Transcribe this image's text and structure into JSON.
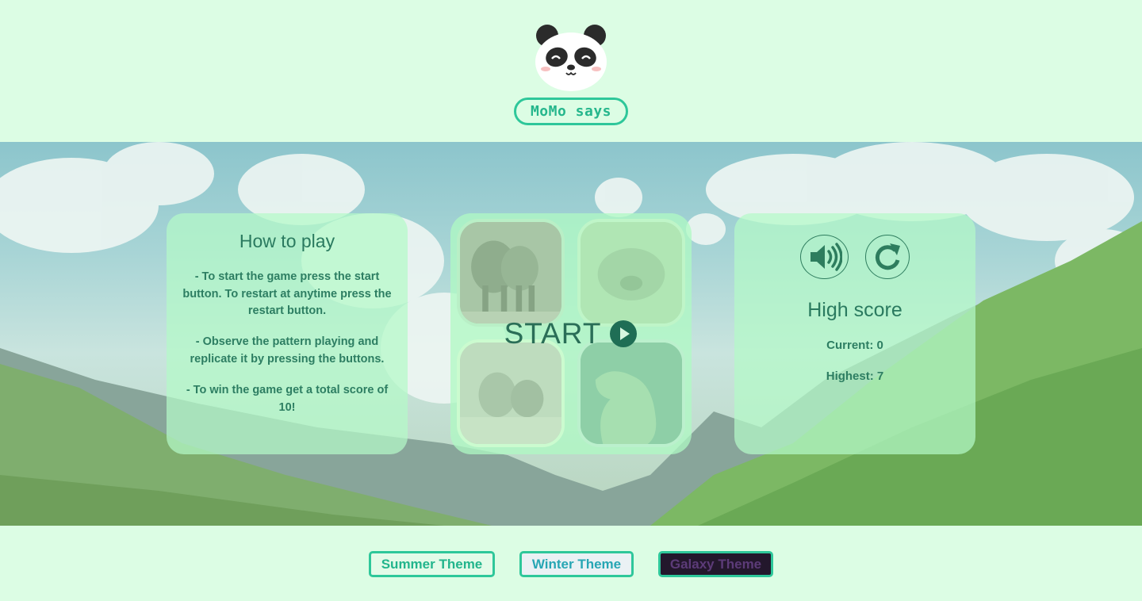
{
  "header": {
    "logo_icon": "panda-face-icon",
    "app_title": "MoMo says"
  },
  "instructions": {
    "title": "How to play",
    "rules": [
      "- To start the game press the start button. To restart at anytime press the restart button.",
      "- Observe the pattern playing and replicate it by pressing the buttons.",
      "- To win the game get a total score of 10!"
    ]
  },
  "game_board": {
    "tiles": [
      {
        "name": "elephants",
        "icon": "elephant-tile"
      },
      {
        "name": "hippo",
        "icon": "hippo-tile"
      },
      {
        "name": "owls",
        "icon": "owl-tile"
      },
      {
        "name": "seal",
        "icon": "seal-tile"
      }
    ],
    "start_label": "START",
    "start_icon": "play-icon"
  },
  "score_panel": {
    "sound_icon": "volume-icon",
    "restart_icon": "restart-icon",
    "title": "High score",
    "current": "Current: 0",
    "highest": "Highest: 7"
  },
  "themes": {
    "summer": "Summer Theme",
    "winter": "Winter Theme",
    "galaxy": "Galaxy Theme"
  },
  "colors": {
    "page_bg": "#dcfde4",
    "accent": "#2ec79a",
    "text": "#2e7d5e",
    "galaxy_bg": "#23172c"
  }
}
